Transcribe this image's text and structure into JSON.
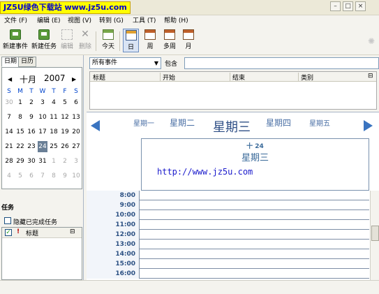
{
  "window": {
    "watermark": "JZ5U绿色下载站 www.jz5u.com",
    "minimize": "–",
    "maximize": "□",
    "close": "×"
  },
  "menu": [
    "文件 (F)",
    "编辑 (E)",
    "视图 (V)",
    "转到 (G)",
    "工具 (T)",
    "帮助 (H)"
  ],
  "toolbar": {
    "new_event": "新建事件",
    "new_task": "新建任务",
    "edit": "编辑",
    "delete": "删除",
    "today": "今天",
    "day": "日",
    "week": "周",
    "multi_week": "多周",
    "month": "月"
  },
  "left": {
    "tab_date": "日期",
    "tab_calendar": "日历",
    "month_label": "十月",
    "year_label": "2007",
    "weekdays": [
      "S",
      "M",
      "T",
      "W",
      "T",
      "F",
      "S"
    ],
    "weeks": [
      [
        "30",
        "1",
        "2",
        "3",
        "4",
        "5",
        "6"
      ],
      [
        "7",
        "8",
        "9",
        "10",
        "11",
        "12",
        "13"
      ],
      [
        "14",
        "15",
        "16",
        "17",
        "18",
        "19",
        "20"
      ],
      [
        "21",
        "22",
        "23",
        "24",
        "25",
        "26",
        "27"
      ],
      [
        "28",
        "29",
        "30",
        "31",
        "1",
        "2",
        "3"
      ],
      [
        "4",
        "5",
        "6",
        "7",
        "8",
        "9",
        "10"
      ]
    ],
    "selected_day": "24",
    "tasks_header": "任务",
    "hide_completed": "隐藏已完成任务",
    "task_col_title": "标题",
    "task_col_priority": "!"
  },
  "filter": {
    "selected": "所有事件",
    "contains_label": "包含",
    "contains_value": ""
  },
  "event_columns": [
    "标题",
    "开始",
    "结束",
    "类别"
  ],
  "dayview": {
    "days": [
      "星期一",
      "星期二",
      "星期三",
      "星期四",
      "星期五"
    ],
    "current_date": "十 24",
    "current_day": "星期三",
    "event_text": "http://www.jz5u.com",
    "hours": [
      "8:00",
      "9:00",
      "10:00",
      "11:00",
      "12:00",
      "13:00",
      "14:00",
      "15:00",
      "16:00"
    ]
  }
}
